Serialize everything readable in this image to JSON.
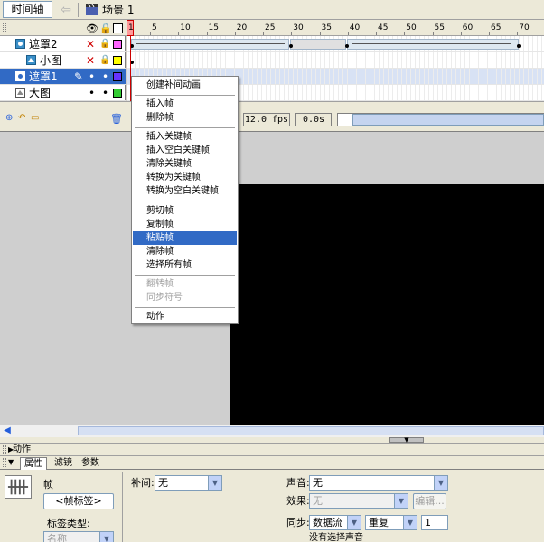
{
  "window": {
    "timeline_tab": "时间轴",
    "scene_label": "场景 1"
  },
  "timeline": {
    "ruler_labels": [
      "1",
      "5",
      "10",
      "15",
      "20",
      "25",
      "30",
      "35",
      "40",
      "45",
      "50",
      "55",
      "60",
      "65",
      "70"
    ],
    "layers": [
      {
        "name": "遮罩2",
        "icon": "mask-layer-icon",
        "eye": "✕",
        "lock": "🔒",
        "color": "#ff66ff",
        "selected": false
      },
      {
        "name": "小图",
        "icon": "masked-layer-icon",
        "eye": "✕",
        "lock": "🔒",
        "color": "#ffff00",
        "selected": false
      },
      {
        "name": "遮罩1",
        "icon": "mask-layer-icon",
        "eye": "•",
        "lock": "•",
        "color": "#6633ff",
        "selected": true
      },
      {
        "name": "大图",
        "icon": "masked-layer-icon",
        "eye": "•",
        "lock": "•",
        "color": "#33cc33",
        "selected": false
      }
    ],
    "fps": "12.0 fps",
    "time": "0.0s"
  },
  "context_menu": {
    "items": [
      {
        "label": "创建补间动画",
        "state": "normal"
      },
      {
        "label": "插入帧",
        "state": "normal"
      },
      {
        "label": "删除帧",
        "state": "normal"
      },
      {
        "label": "插入关键帧",
        "state": "normal"
      },
      {
        "label": "插入空白关键帧",
        "state": "normal"
      },
      {
        "label": "清除关键帧",
        "state": "normal"
      },
      {
        "label": "转换为关键帧",
        "state": "normal"
      },
      {
        "label": "转换为空白关键帧",
        "state": "normal"
      },
      {
        "label": "剪切帧",
        "state": "normal"
      },
      {
        "label": "复制帧",
        "state": "normal"
      },
      {
        "label": "粘贴帧",
        "state": "highlighted"
      },
      {
        "label": "清除帧",
        "state": "normal"
      },
      {
        "label": "选择所有帧",
        "state": "normal"
      },
      {
        "label": "翻转帧",
        "state": "disabled"
      },
      {
        "label": "同步符号",
        "state": "disabled"
      },
      {
        "label": "动作",
        "state": "normal"
      }
    ]
  },
  "actions_panel": {
    "title": "动作"
  },
  "properties": {
    "tabs": [
      "属性",
      "滤镜",
      "参数"
    ],
    "frame_label": "帧",
    "frame_label_field": "<帧标签>",
    "label_type_label": "标签类型:",
    "label_type_value": "名称",
    "tween_label": "补间:",
    "tween_value": "无",
    "sound_label": "声音:",
    "sound_value": "无",
    "effect_label": "效果:",
    "effect_value": "无",
    "edit_button": "编辑...",
    "sync_label": "同步:",
    "sync_value": "数据流",
    "repeat_value": "重复",
    "repeat_count": "1",
    "no_sound_text": "没有选择声音"
  },
  "colors": {
    "selection": "#316ac5",
    "panel_bg": "#ece9d8",
    "stage_bg": "#000000",
    "playhead": "#cc0000"
  }
}
